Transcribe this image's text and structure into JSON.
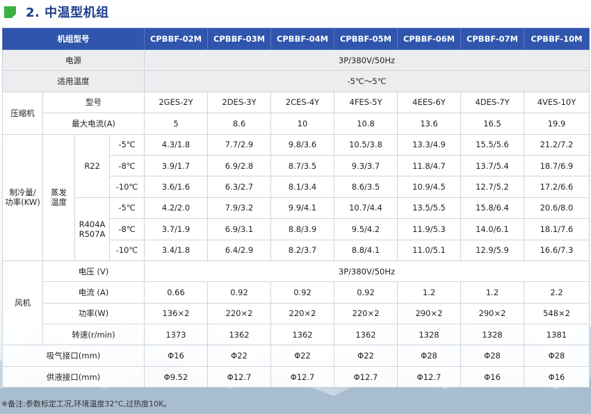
{
  "heading": {
    "title": "2. 中温型机组"
  },
  "table": {
    "header_label": "机组型号",
    "models": [
      "CPBBF-02M",
      "CPBBF-03M",
      "CPBBF-04M",
      "CPBBF-05M",
      "CPBBF-06M",
      "CPBBF-07M",
      "CPBBF-10M"
    ],
    "power_label": "电源",
    "power_value": "3P/380V/50Hz",
    "temp_label": "适用温度",
    "temp_value": "-5℃～5℃",
    "compressor": {
      "group_label": "压缩机",
      "type_label": "型号",
      "types": [
        "2GES-2Y",
        "2DES-3Y",
        "2CES-4Y",
        "4FES-5Y",
        "4EES-6Y",
        "4DES-7Y",
        "4VES-10Y"
      ],
      "current_label": "最大电流(A)",
      "currents": [
        "5",
        "8.6",
        "10",
        "10.8",
        "13.6",
        "16.5",
        "19.9"
      ]
    },
    "cooling": {
      "group_label_line1": "制冷量/",
      "group_label_line2": "功率(KW)",
      "evap_line1": "蒸发",
      "evap_line2": "温度",
      "r22_label": "R22",
      "r404_line1": "R404A",
      "r404_line2": "R507A",
      "r22_rows": [
        {
          "temp": "-5℃",
          "values": [
            "4.3/1.8",
            "7.7/2.9",
            "9.8/3.6",
            "10.5/3.8",
            "13.3/4.9",
            "15.5/5.6",
            "21.2/7.2"
          ]
        },
        {
          "temp": "-8℃",
          "values": [
            "3.9/1.7",
            "6.9/2.8",
            "8.7/3.5",
            "9.3/3.7",
            "11.8/4.7",
            "13.7/5.4",
            "18.7/6.9"
          ]
        },
        {
          "temp": "-10℃",
          "values": [
            "3.6/1.6",
            "6.3/2.7",
            "8.1/3.4",
            "8.6/3.5",
            "10.9/4.5",
            "12.7/5.2",
            "17.2/6.6"
          ]
        }
      ],
      "r404_rows": [
        {
          "temp": "-5℃",
          "values": [
            "4.2/2.0",
            "7.9/3.2",
            "9.9/4.1",
            "10.7/4.4",
            "13.5/5.5",
            "15.8/6.4",
            "20.6/8.0"
          ]
        },
        {
          "temp": "-8℃",
          "values": [
            "3.7/1.9",
            "6.9/3.1",
            "8.8/3.9",
            "9.5/4.2",
            "11.9/5.3",
            "14.0/6.1",
            "18.1/7.6"
          ]
        },
        {
          "temp": "-10℃",
          "values": [
            "3.4/1.8",
            "6.4/2.9",
            "8.2/3.7",
            "8.8/4.1",
            "11.0/5.1",
            "12.9/5.9",
            "16.6/7.3"
          ]
        }
      ]
    },
    "fan": {
      "group_label": "风机",
      "voltage_label": "电压 (V)",
      "voltage_value": "3P/380V/50Hz",
      "current_label": "电流 (A)",
      "currents": [
        "0.66",
        "0.92",
        "0.92",
        "0.92",
        "1.2",
        "1.2",
        "2.2"
      ],
      "power_label": "功率(W)",
      "powers": [
        "136×2",
        "220×2",
        "220×2",
        "220×2",
        "290×2",
        "290×2",
        "548×2"
      ],
      "speed_label": "转速(r/min)",
      "speeds": [
        "1373",
        "1362",
        "1362",
        "1362",
        "1328",
        "1328",
        "1381"
      ]
    },
    "suction": {
      "label": "吸气接口(mm)",
      "values": [
        "Φ16",
        "Φ22",
        "Φ22",
        "Φ22",
        "Φ28",
        "Φ28",
        "Φ28"
      ]
    },
    "liquid": {
      "label": "供液接口(mm)",
      "values": [
        "Φ9.52",
        "Φ12.7",
        "Φ12.7",
        "Φ12.7",
        "Φ12.7",
        "Φ16",
        "Φ16"
      ]
    }
  },
  "note": {
    "text": "※备注:参数标定工况,环境温度32°C,过热度10K。"
  },
  "colors": {
    "header_bg": "#2f55ad",
    "accent_green": "#3cb043",
    "title_blue": "#1c3f8e"
  }
}
